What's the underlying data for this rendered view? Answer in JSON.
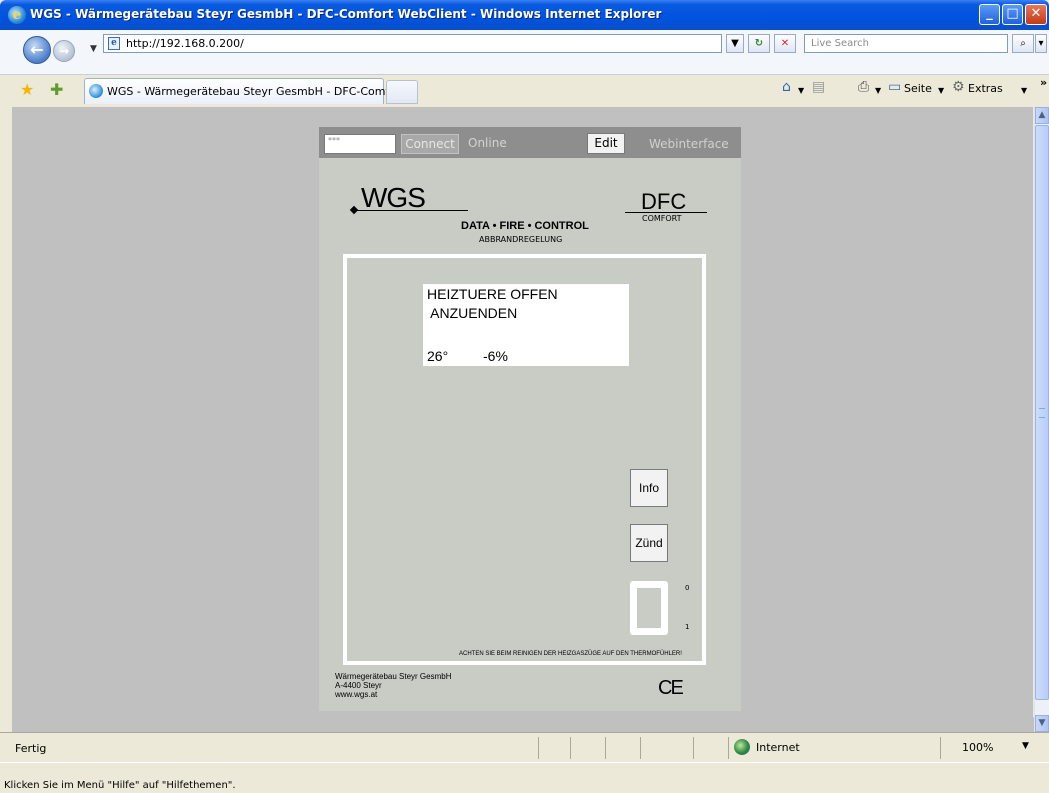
{
  "window": {
    "title": "WGS - Wärmegerätebau Steyr GesmbH - DFC-Comfort WebClient - Windows Internet Explorer"
  },
  "address_bar": {
    "url": "http://192.168.0.200/",
    "search_placeholder": "Live Search"
  },
  "tab": {
    "label": "WGS - Wärmegerätebau Steyr GesmbH - DFC-Comfor..."
  },
  "command_bar": {
    "seite": "Seite",
    "extras": "Extras"
  },
  "device": {
    "password_value": "***",
    "connect_label": "Connect",
    "online_label": "Online",
    "edit_label": "Edit",
    "webinterface_label": "Webinterface",
    "brand_logo": "WGS",
    "product_logo": "DFC",
    "product_sub": "COMFORT",
    "tagline": "DATA • FIRE • CONTROL",
    "subline": "ABBRANDREGELUNG",
    "display": {
      "line1": "HEIZTUERE OFFEN",
      "line2": " ANZUENDEN",
      "temperature": "26°",
      "percentage": "-6%"
    },
    "info_button": "Info",
    "zuend_button": "Zünd",
    "switch_label_0": "0",
    "switch_label_1": "1",
    "warning": "ACHTEN SIE BEIM REINIGEN DER HEIZGASZÜGE AUF DEN THERMOFÜHLER!",
    "footer_company": "Wärmegerätebau Steyr GesmbH\nA-4400 Steyr\nwww.wgs.at",
    "ce_mark": "CE"
  },
  "status_bar": {
    "status": "Fertig",
    "zone": "Internet",
    "zoom": "100%"
  },
  "hint": "Klicken Sie im Menü \"Hilfe\" auf \"Hilfethemen\"."
}
